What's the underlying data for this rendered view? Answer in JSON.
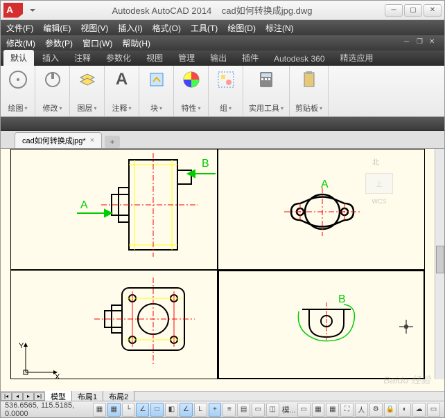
{
  "title": {
    "app": "Autodesk AutoCAD 2014",
    "file": "cad如何转换成jpg.dwg"
  },
  "menu1": [
    "文件(F)",
    "编辑(E)",
    "视图(V)",
    "插入(I)",
    "格式(O)",
    "工具(T)",
    "绘图(D)",
    "标注(N)"
  ],
  "menu2": [
    "修改(M)",
    "参数(P)",
    "窗口(W)",
    "帮助(H)"
  ],
  "ribbonTabs": [
    "默认",
    "插入",
    "注释",
    "参数化",
    "视图",
    "管理",
    "输出",
    "插件",
    "Autodesk 360",
    "精选应用"
  ],
  "panels": {
    "draw": "绘图",
    "modify": "修改",
    "layer": "图层",
    "annotate": "注释",
    "block": "块",
    "props": "特性",
    "group": "组",
    "utils": "实用工具",
    "clipboard": "剪贴板"
  },
  "filetab": {
    "name": "cad如何转换成jpg*"
  },
  "layoutTabs": {
    "model": "模型",
    "l1": "布局1",
    "l2": "布局2"
  },
  "status": {
    "coords": "536.6565, 115.5185, 0.0000",
    "model": "模..."
  },
  "viewcube": {
    "top": "上",
    "wcs": "WCS"
  },
  "labels": {
    "A": "A",
    "B": "B"
  },
  "watermark": "Baidu 经验"
}
